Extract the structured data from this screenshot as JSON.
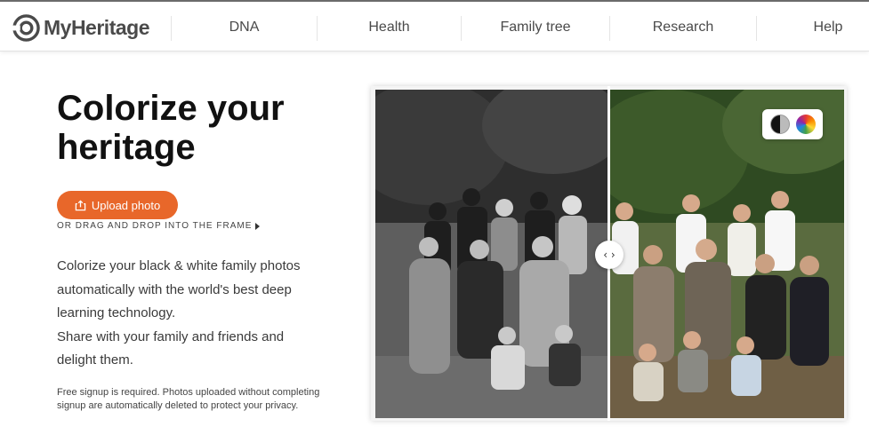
{
  "header": {
    "brand": "MyHeritage",
    "nav": [
      "DNA",
      "Health",
      "Family tree",
      "Research",
      "Help"
    ]
  },
  "hero": {
    "title_line1": "Colorize your",
    "title_line2": "heritage",
    "upload_label": "Upload photo",
    "drag_hint": "OR DRAG AND DROP INTO THE FRAME",
    "description_1": "Colorize your black & white family photos automatically with the world's best deep learning technology.",
    "description_2": "Share with your family and friends and delight them.",
    "fineprint": "Free signup is required. Photos uploaded without completing signup are automatically deleted to protect your privacy."
  },
  "colors": {
    "accent": "#e8672a",
    "text": "#2b2b2b"
  },
  "icons": [
    "myheritage-logo-icon",
    "upload-icon",
    "play-triangle-icon",
    "compare-arrows-icon",
    "black-white-toggle-icon",
    "color-toggle-icon"
  ]
}
